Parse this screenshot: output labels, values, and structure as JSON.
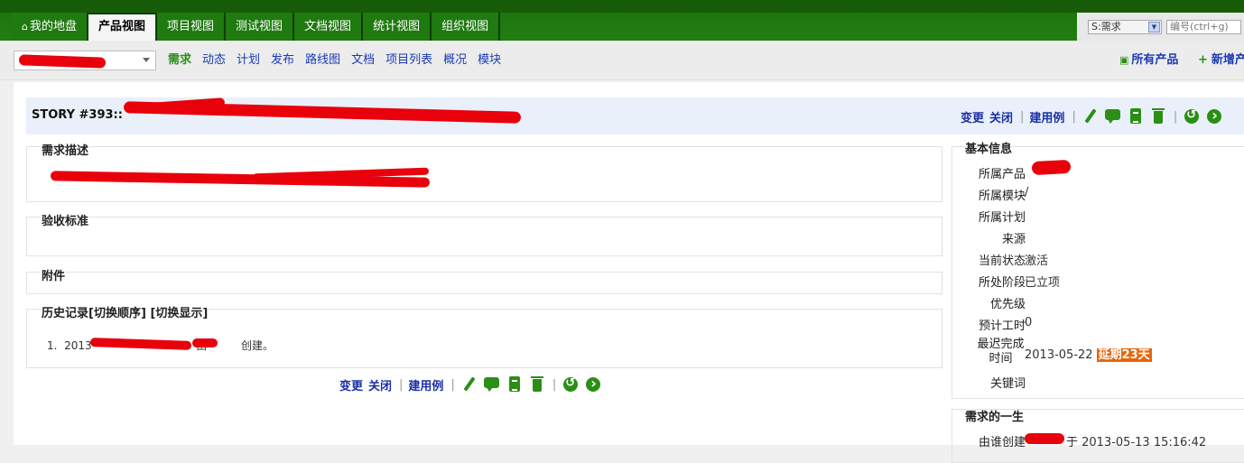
{
  "nav": {
    "tabs": [
      {
        "label": "我的地盘",
        "active": false
      },
      {
        "label": "产品视图",
        "active": true
      },
      {
        "label": "项目视图",
        "active": false
      },
      {
        "label": "测试视图",
        "active": false
      },
      {
        "label": "文档视图",
        "active": false
      },
      {
        "label": "统计视图",
        "active": false
      },
      {
        "label": "组织视图",
        "active": false
      }
    ]
  },
  "search": {
    "type_selected": "S:需求",
    "placeholder": "编号(ctrl+g)"
  },
  "subnav": {
    "menu": [
      "需求",
      "动态",
      "计划",
      "发布",
      "路线图",
      "文档",
      "项目列表",
      "概况",
      "模块"
    ],
    "active": "需求",
    "all_products": "所有产品",
    "add_new": "新增产"
  },
  "story": {
    "title_prefix": "STORY #393::",
    "description_label": "需求描述",
    "acceptance_label": "验收标准",
    "attachments_label": "附件",
    "history_label": "历史记录",
    "toggle_order": "[切换顺序]",
    "toggle_display": "[切换显示]",
    "history_items": [
      {
        "index": "1.",
        "date_prefix": "2013",
        "by": "由",
        "action": "创建。"
      }
    ]
  },
  "actions": {
    "change": "变更",
    "close": "关闭",
    "create_case": "建用例",
    "icons": [
      "edit-icon",
      "comment-icon",
      "copy-icon",
      "delete-icon",
      "back-icon",
      "next-icon"
    ]
  },
  "basic_info": {
    "heading": "基本信息",
    "rows": [
      {
        "label": "所属产品",
        "value": ""
      },
      {
        "label": "所属模块",
        "value": "/"
      },
      {
        "label": "所属计划",
        "value": ""
      },
      {
        "label": "来源",
        "value": ""
      },
      {
        "label": "当前状态",
        "value": "激活"
      },
      {
        "label": "所处阶段",
        "value": "已立项"
      },
      {
        "label": "优先级",
        "value": ""
      },
      {
        "label": "预计工时",
        "value": "0"
      },
      {
        "label": "最迟完成时间",
        "value": "2013-05-22"
      },
      {
        "label": "关键词",
        "value": ""
      }
    ],
    "delay_badge": "延期23天"
  },
  "lifecycle": {
    "heading": "需求的一生",
    "created_label": "由谁创建",
    "created_at": "于 2013-05-13 15:16:42"
  },
  "colors": {
    "nav_green": "#1f7a0f",
    "link_blue": "#1a3bb5",
    "icon_green": "#2a8f14",
    "delay_orange": "#e8650a",
    "title_bg": "#e9f0fa"
  }
}
